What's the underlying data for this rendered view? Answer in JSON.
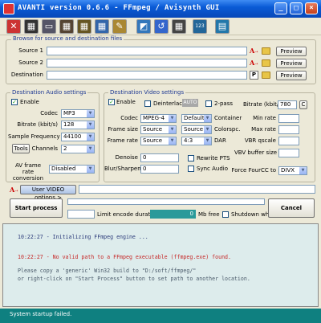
{
  "window": {
    "title": "AVANTI  version  0.6.6  -  FFmpeg / Avisynth GUI",
    "controls": {
      "minimize": "_",
      "maximize": "□",
      "close": "×"
    }
  },
  "toolbar": {
    "buttons": [
      {
        "name": "exit-icon",
        "glyph": "✕",
        "color": "#cc3333"
      },
      {
        "name": "film-icon",
        "glyph": "▦",
        "color": "#333333"
      },
      {
        "name": "disk-icon",
        "glyph": "▭",
        "color": "#555566"
      },
      {
        "name": "film-add-icon",
        "glyph": "▦",
        "color": "#554433"
      },
      {
        "name": "film-edit-icon",
        "glyph": "▦",
        "color": "#665522"
      },
      {
        "name": "grid-icon",
        "glyph": "▦",
        "color": "#3366aa"
      },
      {
        "name": "pencil-icon",
        "glyph": "✎",
        "color": "#aa8833"
      },
      {
        "name": "filter-icon",
        "glyph": "◩",
        "color": "#3377bb"
      },
      {
        "name": "reload-icon",
        "glyph": "↺",
        "color": "#3366cc"
      },
      {
        "name": "film-strip-icon",
        "glyph": "▦",
        "color": "#444444"
      },
      {
        "name": "numbers-icon",
        "glyph": "123",
        "color": "#226699"
      },
      {
        "name": "encode-icon",
        "glyph": "▤",
        "color": "#2277aa"
      }
    ]
  },
  "browse": {
    "title": "Browse for source and destination files",
    "source1_label": "Source 1",
    "source2_label": "Source 2",
    "destination_label": "Destination",
    "source1_value": "",
    "source2_value": "",
    "destination_value": "",
    "preview_label": "Preview",
    "p_label": "P"
  },
  "audio": {
    "title": "Destination Audio settings",
    "enable_label": "Enable",
    "codec_label": "Codec",
    "codec_value": "MP3",
    "bitrate_label": "Bitrate (kbit/s)",
    "bitrate_value": "128",
    "sample_label": "Sample Frequency",
    "sample_value": "44100",
    "tools_label": "Tools",
    "channels_label": "Channels",
    "channels_value": "2",
    "av_rate_label": "AV frame rate conversion",
    "av_rate_value": "Disabled"
  },
  "video": {
    "title": "Destination Video settings",
    "enable_label": "Enable",
    "deinterlace_label": "Deinterlace",
    "auto_label": "AUTO",
    "twopass_label": "2-pass",
    "bitrate_label": "Bitrate (kbit/s)",
    "bitrate_value": "780",
    "c_label": "C",
    "codec_label": "Codec",
    "codec_value": "MPEG-4",
    "container_value": "Default",
    "container_label": "Container",
    "framesize_label": "Frame size",
    "framesize_value1": "Source",
    "framesize_value2": "Source",
    "colorspc_label": "Colorspc.",
    "framerate_label": "Frame rate",
    "framerate_value": "Source",
    "dar_value": "4:3",
    "dar_label": "DAR",
    "minrate_label": "Min rate",
    "maxrate_label": "Max rate",
    "vbrq_label": "VBR qscale",
    "vbvbuf_label": "VBV buffer size",
    "denoise_label": "Denoise",
    "denoise_value": "0",
    "blur_label": "Blur/Sharpen",
    "blur_value": "0",
    "rewrite_label": "Rewrite PTS",
    "sync_label": "Sync Audio",
    "fourcc_label": "Force FourCC to",
    "fourcc_value": "DIVX"
  },
  "options": {
    "user_video_label": "User VIDEO options >",
    "user_video_value": ""
  },
  "process": {
    "start_label": "Start process",
    "cancel_label": "Cancel",
    "limit_label": "Limit encode duration",
    "mb_value": "0",
    "mb_label": "Mb free",
    "shutdown_label": "Shutdown when finished"
  },
  "log": {
    "line1": "10:22:27 - Initializing FFmpeg engine ...",
    "line2": "10:22:27 - No valid path to a FFmpeg executable (ffmpeg.exe) found.",
    "line3": "Please copy a 'generic' Win32 build to \"D:/soft/ffmpeg/\"",
    "line4": "or right-click on \"Start Process\" button to set path to another location."
  },
  "status": {
    "text": "System startup failed."
  },
  "colors": {
    "status_bg": "#0f8080",
    "log_bg": "#ddecec",
    "mb_fill": "#2a9a9a",
    "error_text": "#c62828"
  }
}
